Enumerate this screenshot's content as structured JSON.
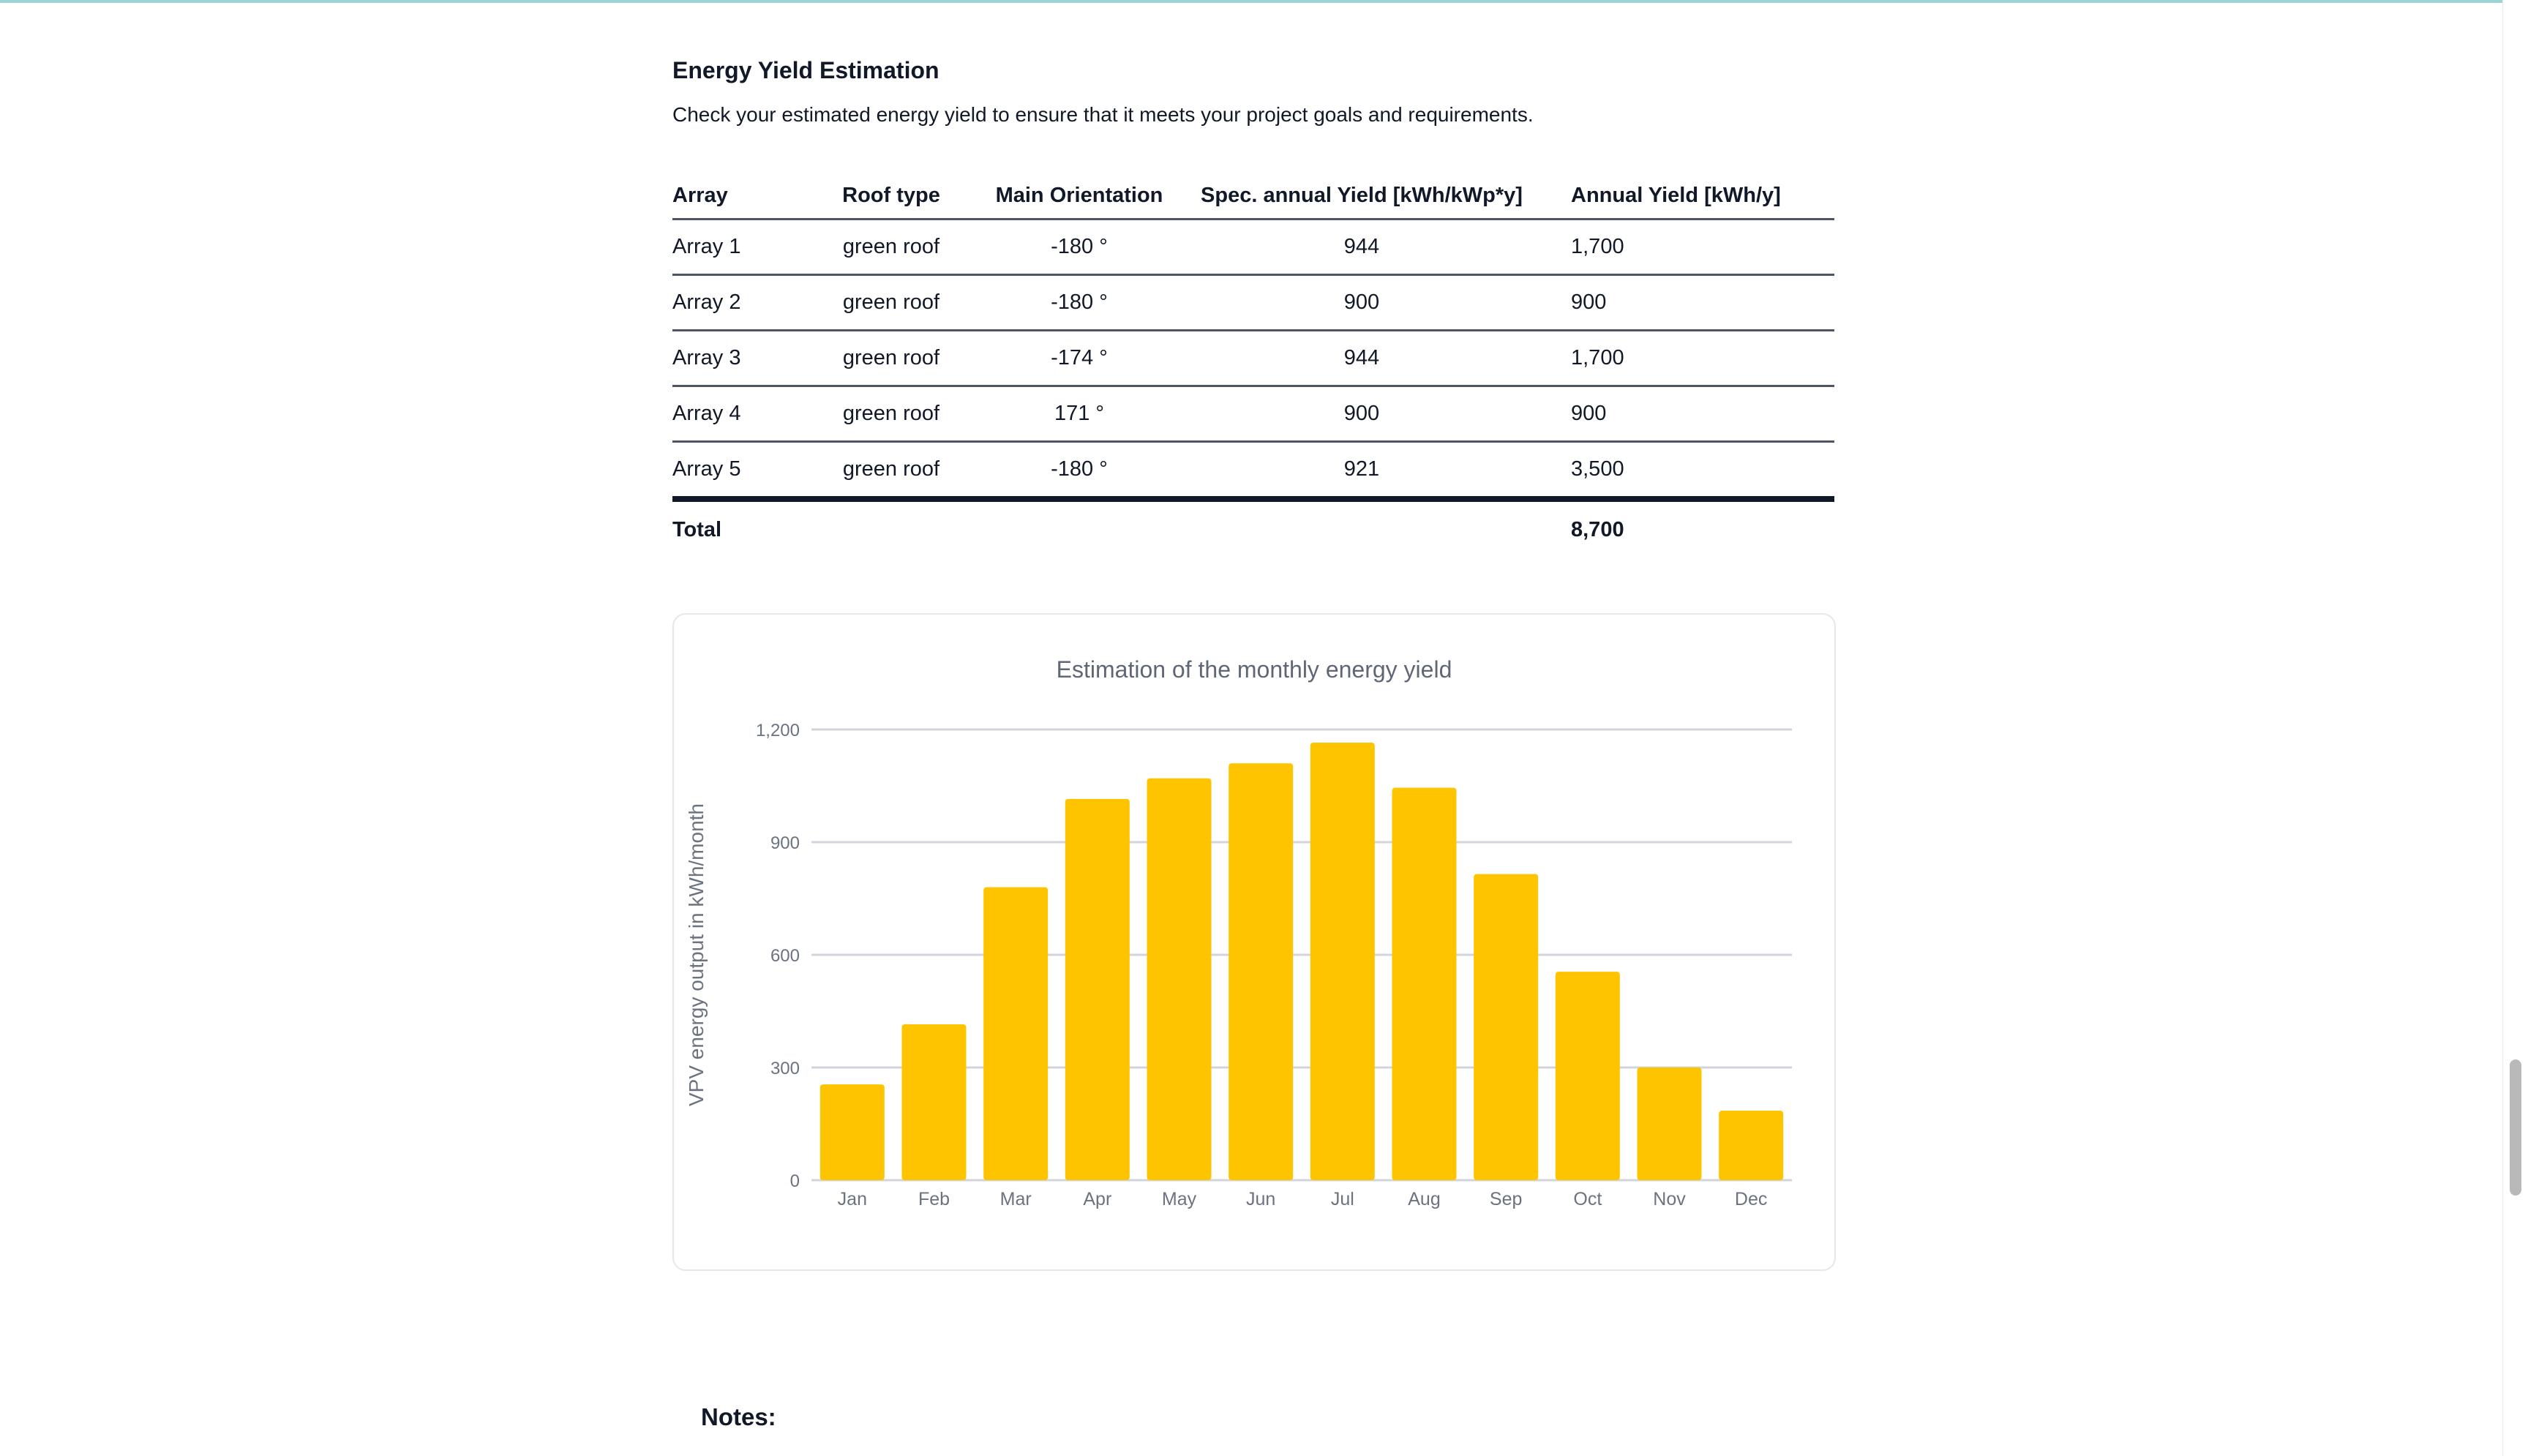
{
  "section": {
    "title": "Energy Yield Estimation",
    "description": "Check your estimated energy yield to ensure that it meets your project goals and requirements."
  },
  "table": {
    "headers": [
      "Array",
      "Roof type",
      "Main Orientation",
      "Spec. annual Yield [kWh/kWp*y]",
      "Annual Yield [kWh/y]"
    ],
    "rows": [
      [
        "Array 1",
        "green roof",
        "-180 °",
        "944",
        "1,700"
      ],
      [
        "Array 2",
        "green roof",
        "-180 °",
        "900",
        "900"
      ],
      [
        "Array 3",
        "green roof",
        "-174 °",
        "944",
        "1,700"
      ],
      [
        "Array 4",
        "green roof",
        "171 °",
        "900",
        "900"
      ],
      [
        "Array 5",
        "green roof",
        "-180 °",
        "921",
        "3,500"
      ]
    ],
    "total_label": "Total",
    "total_value": "8,700"
  },
  "chart_data": {
    "type": "bar",
    "title": "Estimation of the monthly energy yield",
    "xlabel": "",
    "ylabel": "VPV energy output in kWh/month",
    "categories": [
      "Jan",
      "Feb",
      "Mar",
      "Apr",
      "May",
      "Jun",
      "Jul",
      "Aug",
      "Sep",
      "Oct",
      "Nov",
      "Dec"
    ],
    "values": [
      255,
      415,
      780,
      1015,
      1070,
      1110,
      1165,
      1045,
      815,
      555,
      300,
      185
    ],
    "ylim": [
      0,
      1200
    ],
    "yticks": [
      "0",
      "300",
      "600",
      "900",
      "1,200"
    ],
    "grid": true,
    "bar_color": "#FFC400"
  },
  "notes": {
    "label": "Notes:"
  },
  "colors": {
    "accent_line": "#9ed3d6",
    "text": "#111827"
  }
}
